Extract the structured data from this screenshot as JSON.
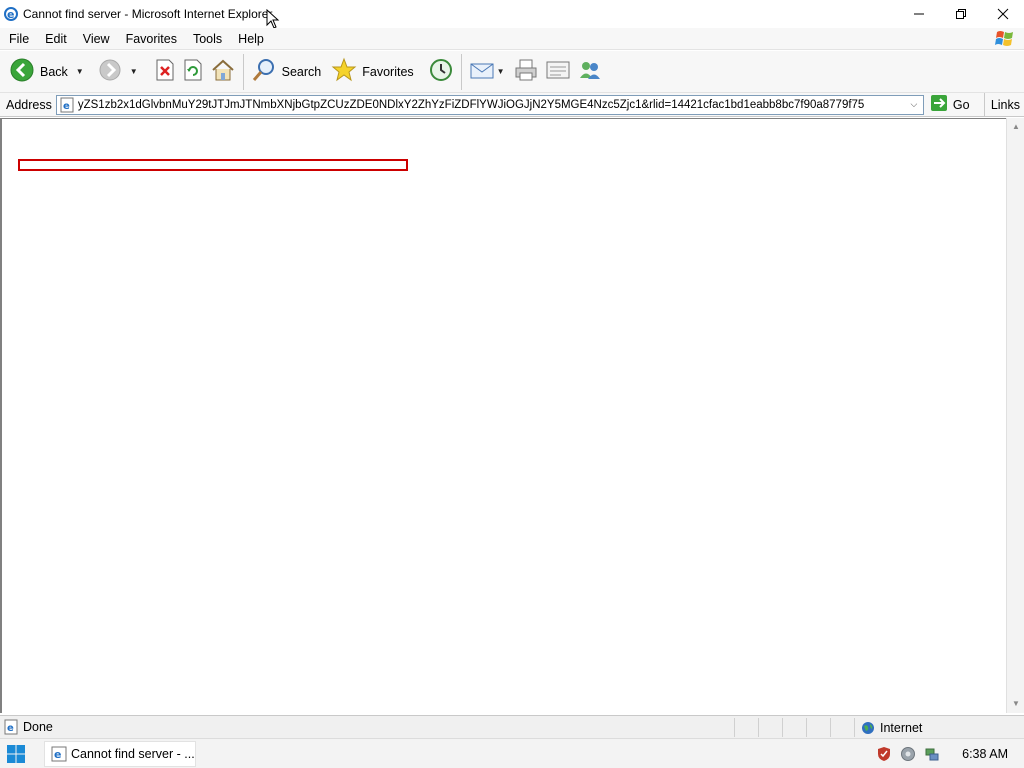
{
  "window": {
    "title": "Cannot find server - Microsoft Internet Explorer"
  },
  "menu": [
    "File",
    "Edit",
    "View",
    "Favorites",
    "Tools",
    "Help"
  ],
  "toolbar": {
    "back_label": "Back",
    "search_label": "Search",
    "favorites_label": "Favorites"
  },
  "address": {
    "label": "Address",
    "url": "yZS1zb2x1dGlvbnMuY29tJTJmJTNmbXNjbGtpZCUzZDE0NDlxY2ZhYzFiZDFlYWJiOGJjN2Y5MGE4Nzc5Zjc1&rlid=14421cfac1bd1eabb8bc7f90a8779f75",
    "go_label": "Go",
    "links_label": "Links"
  },
  "status": {
    "text": "Done",
    "zone": "Internet"
  },
  "taskbar": {
    "task_label": "Cannot find server - ...",
    "clock": "6:38 AM"
  },
  "colors": {
    "accent_green": "#3aa53a",
    "error_border": "#cc0000",
    "ie_blue": "#1f6fc5"
  }
}
